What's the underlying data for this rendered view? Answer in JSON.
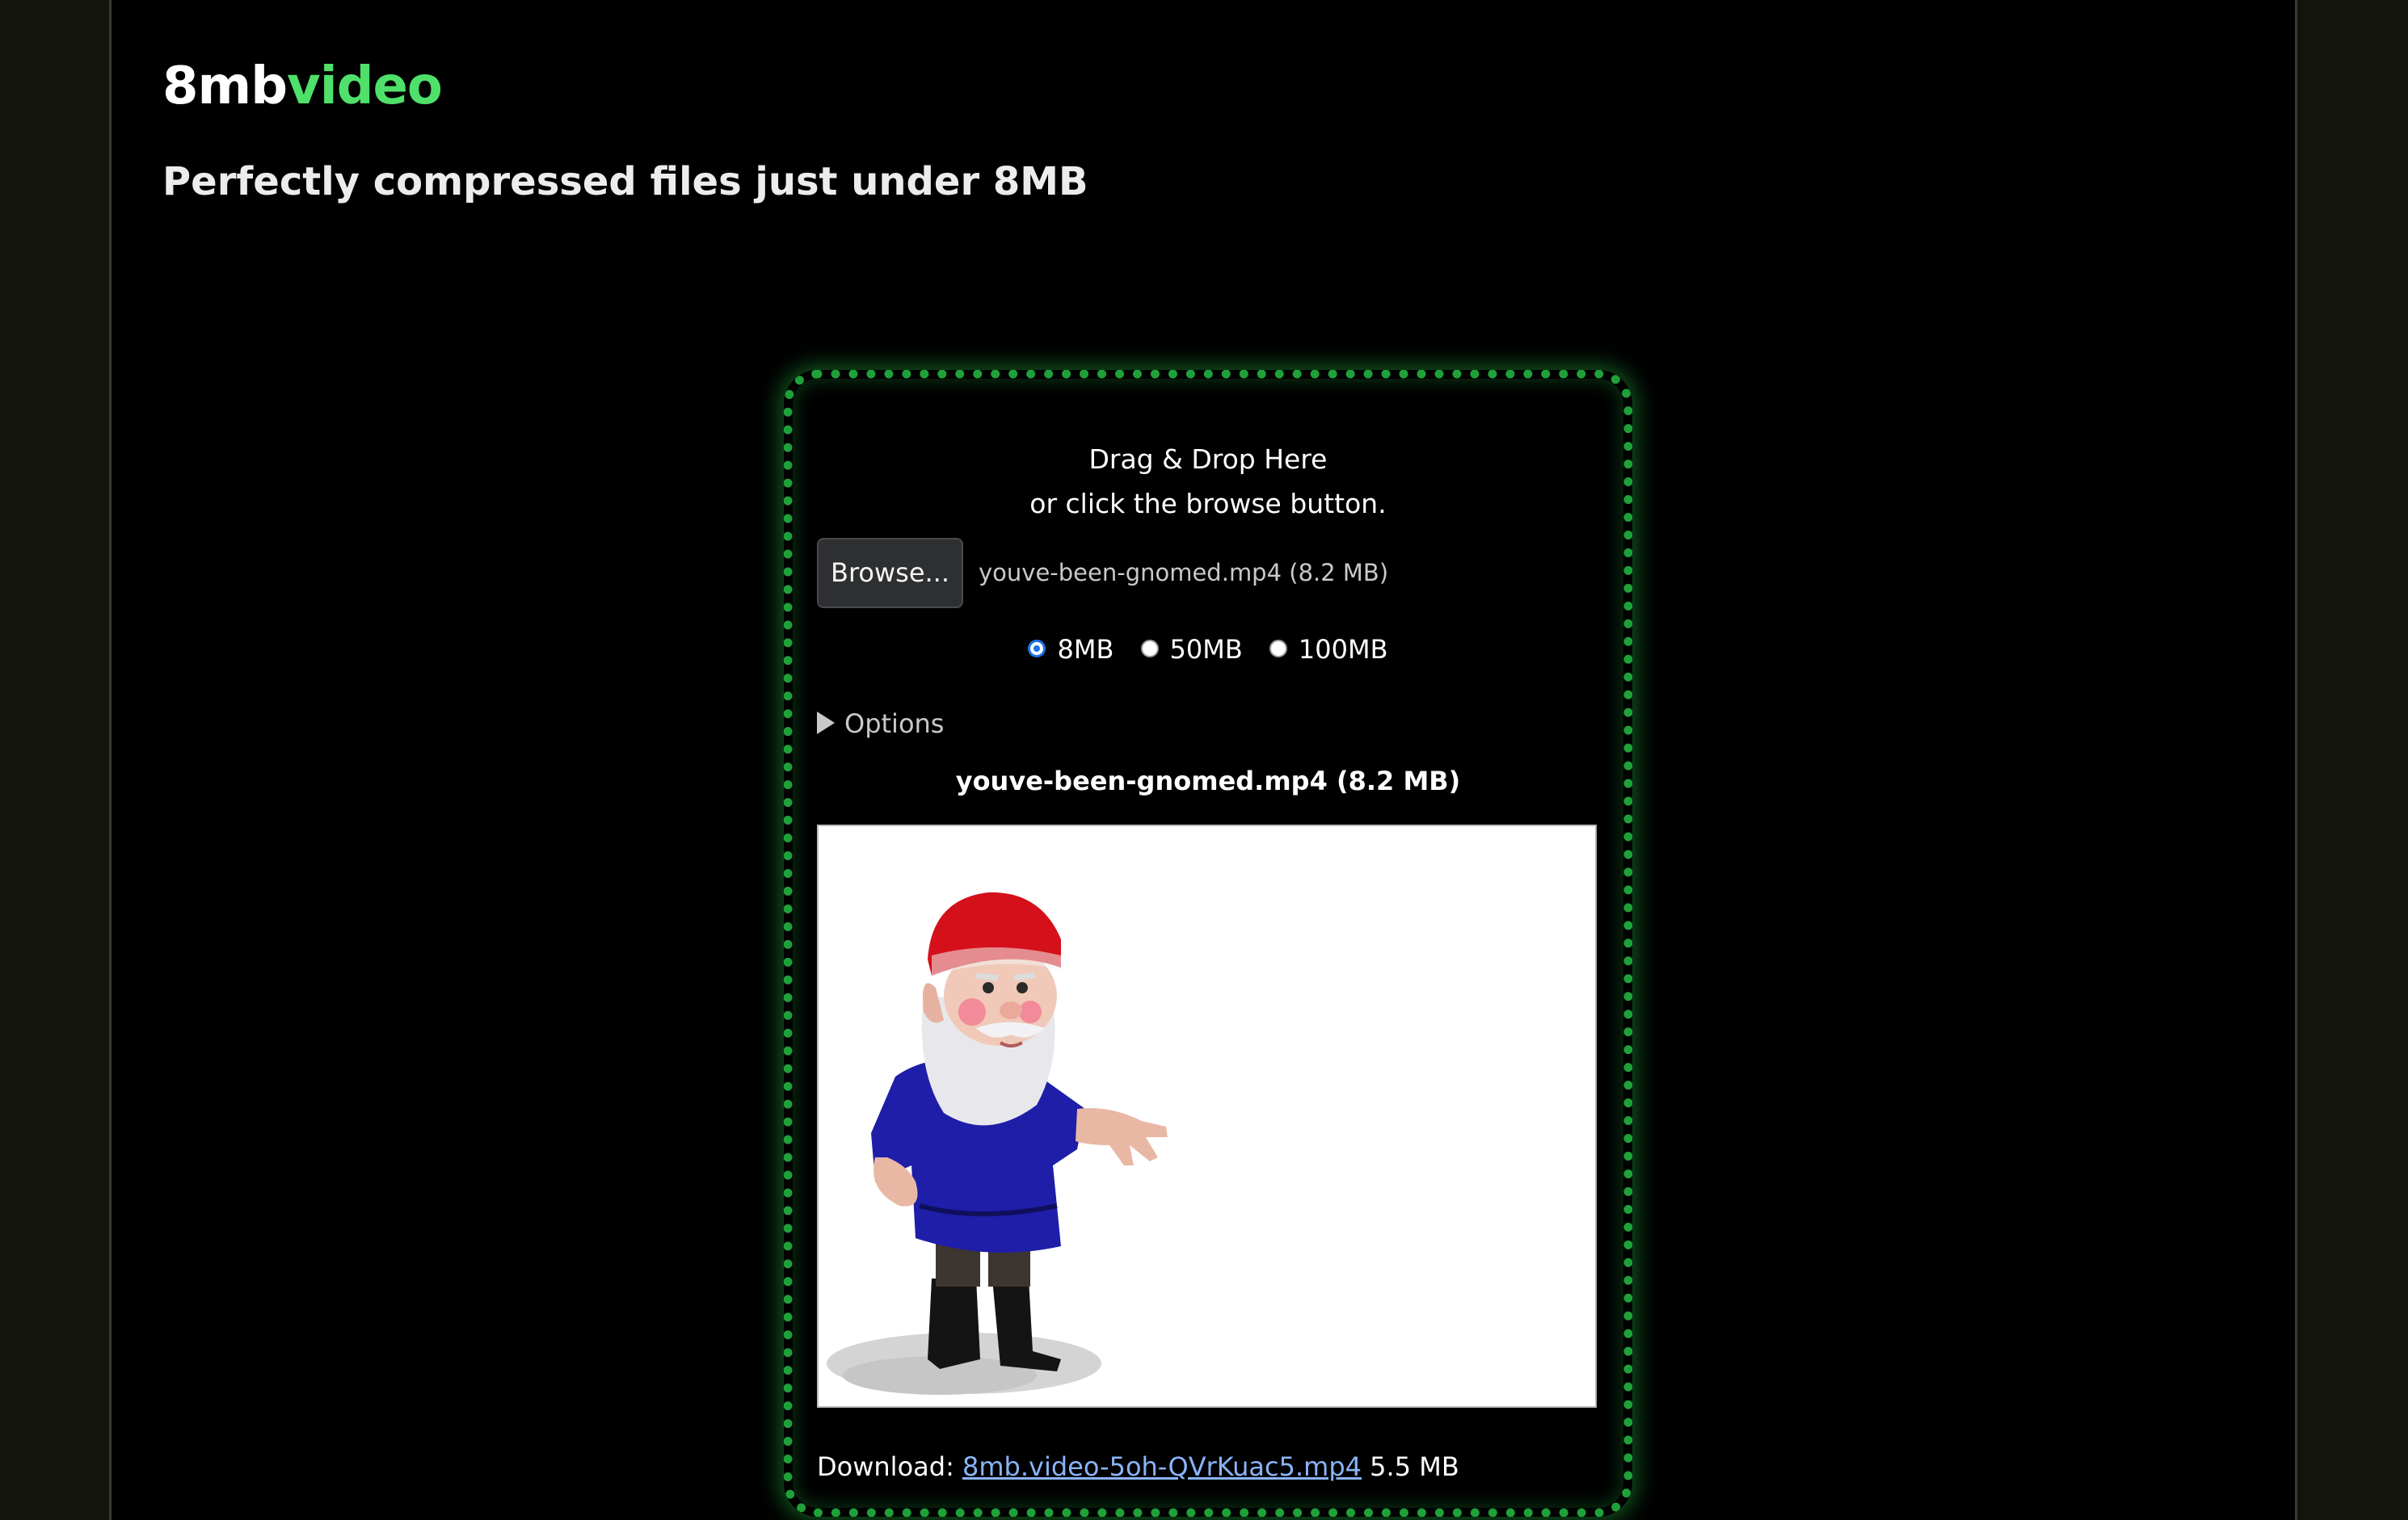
{
  "brand": {
    "name_part1": "8mb",
    "name_part2": "video",
    "accent_color": "#4ee06a"
  },
  "tagline": "Perfectly compressed files just under 8MB",
  "dropzone": {
    "line1": "Drag & Drop Here",
    "line2": "or click the browse button.",
    "border_color": "#1fa13a"
  },
  "file_input": {
    "button_label": "Browse...",
    "selected_file": "youve-been-gnomed.mp4 (8.2 MB)"
  },
  "size_options": [
    {
      "label": "8MB",
      "checked": true
    },
    {
      "label": "50MB",
      "checked": false
    },
    {
      "label": "100MB",
      "checked": false
    }
  ],
  "options_label": "Options",
  "video": {
    "title": "youve-been-gnomed.mp4 (8.2 MB)",
    "preview_description_icon": "gnome-video-frame"
  },
  "download": {
    "label": "Download:",
    "link_text": "8mb.video-5oh-QVrKuac5.mp4",
    "size": "5.5 MB",
    "link_color": "#8ab4f8"
  }
}
